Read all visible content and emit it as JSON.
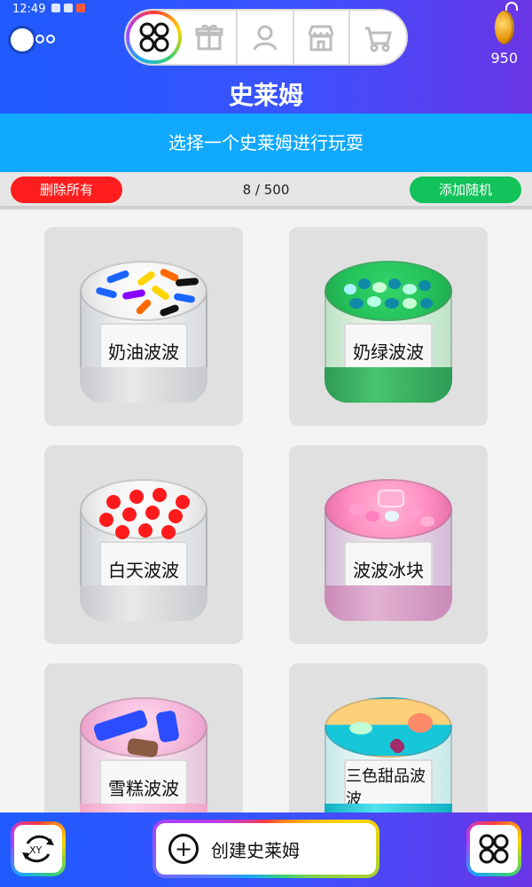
{
  "status": {
    "time": "12:49"
  },
  "header": {
    "title": "史莱姆",
    "coins": "950",
    "nav_icons": [
      "grid-icon",
      "gift-icon",
      "user-icon",
      "shop-icon",
      "cart-icon"
    ]
  },
  "subtitle": "选择一个史莱姆进行玩耍",
  "actions": {
    "delete_all": "删除所有",
    "count": "8 / 500",
    "add_random": "添加随机"
  },
  "slimes": [
    {
      "label": "奶油波波",
      "theme": "white"
    },
    {
      "label": "奶绿波波",
      "theme": "green"
    },
    {
      "label": "白天波波",
      "theme": "red-dots"
    },
    {
      "label": "波波冰块",
      "theme": "pink"
    },
    {
      "label": "雪糕波波",
      "theme": "popsicle"
    },
    {
      "label": "三色甜品波波",
      "theme": "tricolor"
    }
  ],
  "bottom": {
    "create_label": "创建史莱姆",
    "left_icon": "xy-reset-icon",
    "right_icon": "grid-icon"
  },
  "colors": {
    "primary_gradient_start": "#1f5bff",
    "primary_gradient_end": "#6a35e6",
    "subtitle_bar": "#10a9ff",
    "delete_red": "#ff1d1d",
    "add_green": "#12c25a"
  }
}
